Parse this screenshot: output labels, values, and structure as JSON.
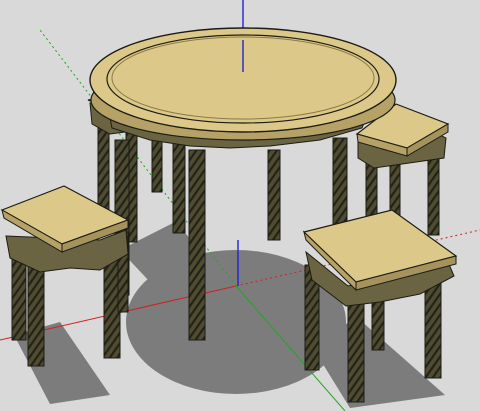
{
  "viewport": {
    "background_color": "#d9d9d9",
    "shadow_color": "#7c7c7c"
  },
  "model": {
    "wood_top_color": "#dcc98a",
    "wood_edge_color": "#b6a167",
    "wood_dark_color": "#5b5838",
    "outline_color": "#1c1c14",
    "objects": [
      {
        "name": "round-table",
        "kind": "table",
        "legs": 4
      },
      {
        "name": "stool-back-left",
        "kind": "stool",
        "legs": 4
      },
      {
        "name": "stool-back-right",
        "kind": "stool",
        "legs": 4
      },
      {
        "name": "stool-front-left",
        "kind": "stool",
        "legs": 4
      },
      {
        "name": "stool-front-right",
        "kind": "stool",
        "legs": 4
      }
    ]
  },
  "axes": {
    "x_color": "#d22020",
    "y_color": "#22a622",
    "z_color": "#2121d8"
  }
}
